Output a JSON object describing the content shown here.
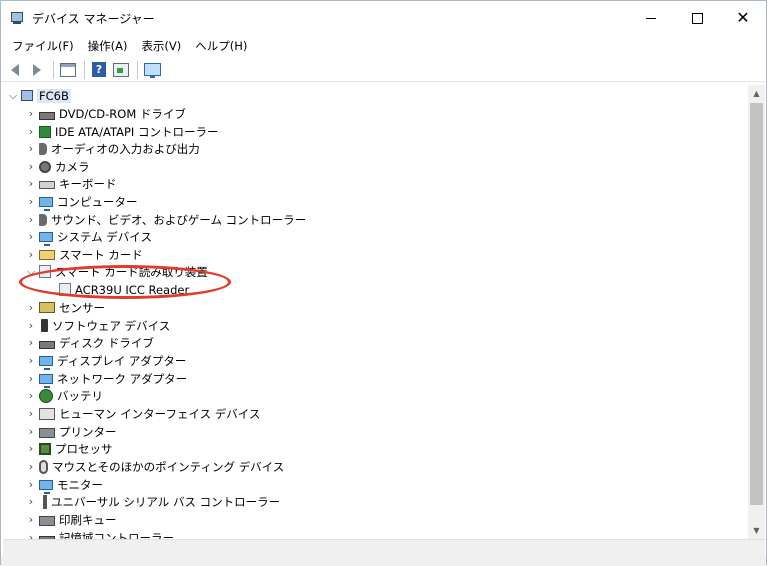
{
  "window": {
    "title": "デバイス マネージャー",
    "minimize_icon": "minimize-icon",
    "maximize_icon": "maximize-icon",
    "close_icon": "close-icon",
    "close_glyph": "✕"
  },
  "menu": [
    "ファイル(F)",
    "操作(A)",
    "表示(V)",
    "ヘルプ(H)"
  ],
  "toolbar": {
    "help_glyph": "?",
    "icons": [
      "back-arrow-icon",
      "forward-arrow-icon",
      "properties-icon",
      "help-icon",
      "update-driver-icon",
      "scan-hardware-icon"
    ]
  },
  "tree": {
    "root": {
      "label": "FC6B",
      "expanded": true,
      "icon": "computer-icon"
    },
    "categories": [
      {
        "label": "DVD/CD-ROM ドライブ",
        "icon": "dvd-drive-icon",
        "expanded": false
      },
      {
        "label": "IDE ATA/ATAPI コントローラー",
        "icon": "ide-controller-icon",
        "expanded": false
      },
      {
        "label": "オーディオの入力および出力",
        "icon": "speaker-icon",
        "expanded": false
      },
      {
        "label": "カメラ",
        "icon": "camera-icon",
        "expanded": false
      },
      {
        "label": "キーボード",
        "icon": "keyboard-icon",
        "expanded": false
      },
      {
        "label": "コンピューター",
        "icon": "computer-monitor-icon",
        "expanded": false
      },
      {
        "label": "サウンド、ビデオ、およびゲーム コントローラー",
        "icon": "sound-icon",
        "expanded": false
      },
      {
        "label": "システム デバイス",
        "icon": "system-device-icon",
        "expanded": false
      },
      {
        "label": "スマート カード",
        "icon": "smart-card-icon",
        "expanded": false
      },
      {
        "label": "スマート カード読み取り装置",
        "icon": "smart-card-reader-icon",
        "expanded": true,
        "children": [
          {
            "label": "ACR39U ICC Reader",
            "icon": "card-reader-device-icon"
          }
        ]
      },
      {
        "label": "センサー",
        "icon": "sensor-icon",
        "expanded": false
      },
      {
        "label": "ソフトウェア デバイス",
        "icon": "software-device-icon",
        "expanded": false
      },
      {
        "label": "ディスク ドライブ",
        "icon": "disk-drive-icon",
        "expanded": false
      },
      {
        "label": "ディスプレイ アダプター",
        "icon": "display-adapter-icon",
        "expanded": false
      },
      {
        "label": "ネットワーク アダプター",
        "icon": "network-adapter-icon",
        "expanded": false
      },
      {
        "label": "バッテリ",
        "icon": "battery-icon",
        "expanded": false
      },
      {
        "label": "ヒューマン インターフェイス デバイス",
        "icon": "hid-icon",
        "expanded": false
      },
      {
        "label": "プリンター",
        "icon": "printer-icon",
        "expanded": false
      },
      {
        "label": "プロセッサ",
        "icon": "processor-icon",
        "expanded": false
      },
      {
        "label": "マウスとそのほかのポインティング デバイス",
        "icon": "mouse-icon",
        "expanded": false
      },
      {
        "label": "モニター",
        "icon": "monitor-icon",
        "expanded": false
      },
      {
        "label": "ユニバーサル シリアル バス コントローラー",
        "icon": "usb-icon",
        "expanded": false
      },
      {
        "label": "印刷キュー",
        "icon": "print-queue-icon",
        "expanded": false
      },
      {
        "label": "記憶域コントローラー",
        "icon": "storage-controller-icon",
        "expanded": false
      }
    ]
  },
  "annotation": {
    "color": "#e23b2d",
    "highlights": "スマート カード読み取り装置"
  },
  "colors": {
    "selection": "#dbe7f5",
    "scrollbar_thumb": "#c2c2c2"
  }
}
